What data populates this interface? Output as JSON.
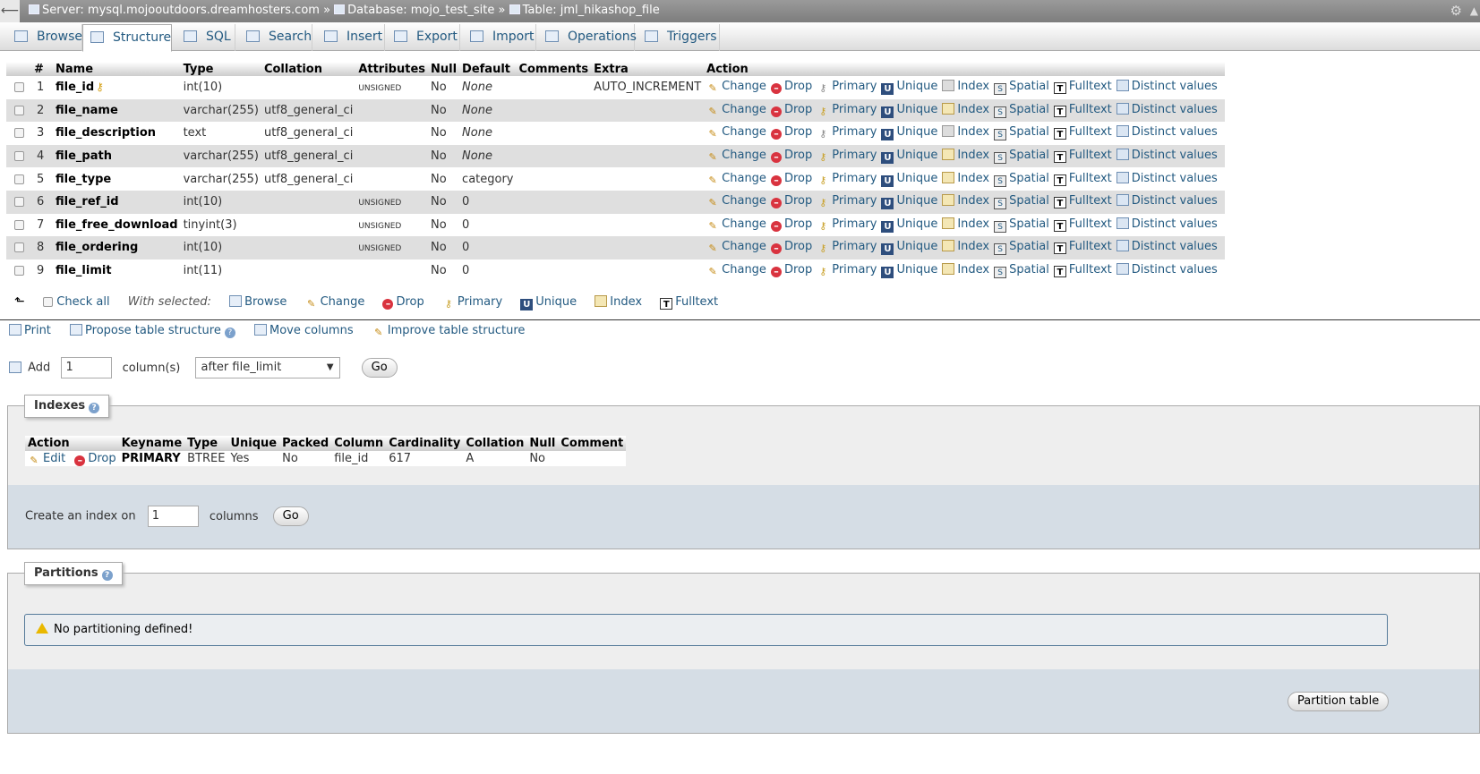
{
  "breadcrumb": {
    "server_label": "Server: mysql.mojooutdoors.dreamhosters.com »",
    "database_label": "Database: mojo_test_site »",
    "table_label": "Table: jml_hikashop_file"
  },
  "tabs": [
    {
      "label": "Browse",
      "icon": "browse-icon"
    },
    {
      "label": "Structure",
      "icon": "structure-icon",
      "active": true
    },
    {
      "label": "SQL",
      "icon": "sql-icon"
    },
    {
      "label": "Search",
      "icon": "search-icon"
    },
    {
      "label": "Insert",
      "icon": "insert-icon"
    },
    {
      "label": "Export",
      "icon": "export-icon"
    },
    {
      "label": "Import",
      "icon": "import-icon"
    },
    {
      "label": "Operations",
      "icon": "operations-icon"
    },
    {
      "label": "Triggers",
      "icon": "triggers-icon"
    }
  ],
  "structure": {
    "headers": [
      "#",
      "Name",
      "Type",
      "Collation",
      "Attributes",
      "Null",
      "Default",
      "Comments",
      "Extra",
      "Action"
    ],
    "rows": [
      {
        "num": "1",
        "name": "file_id",
        "type": "int(10)",
        "collation": "",
        "attributes": "UNSIGNED",
        "null": "No",
        "default": "None",
        "comments": "",
        "extra": "AUTO_INCREMENT"
      },
      {
        "num": "2",
        "name": "file_name",
        "type": "varchar(255)",
        "collation": "utf8_general_ci",
        "attributes": "",
        "null": "No",
        "default": "None",
        "comments": "",
        "extra": ""
      },
      {
        "num": "3",
        "name": "file_description",
        "type": "text",
        "collation": "utf8_general_ci",
        "attributes": "",
        "null": "No",
        "default": "None",
        "comments": "",
        "extra": ""
      },
      {
        "num": "4",
        "name": "file_path",
        "type": "varchar(255)",
        "collation": "utf8_general_ci",
        "attributes": "",
        "null": "No",
        "default": "None",
        "comments": "",
        "extra": ""
      },
      {
        "num": "5",
        "name": "file_type",
        "type": "varchar(255)",
        "collation": "utf8_general_ci",
        "attributes": "",
        "null": "No",
        "default": "category",
        "comments": "",
        "extra": ""
      },
      {
        "num": "6",
        "name": "file_ref_id",
        "type": "int(10)",
        "collation": "",
        "attributes": "UNSIGNED",
        "null": "No",
        "default": "0",
        "comments": "",
        "extra": ""
      },
      {
        "num": "7",
        "name": "file_free_download",
        "type": "tinyint(3)",
        "collation": "",
        "attributes": "UNSIGNED",
        "null": "No",
        "default": "0",
        "comments": "",
        "extra": ""
      },
      {
        "num": "8",
        "name": "file_ordering",
        "type": "int(10)",
        "collation": "",
        "attributes": "UNSIGNED",
        "null": "No",
        "default": "0",
        "comments": "",
        "extra": ""
      },
      {
        "num": "9",
        "name": "file_limit",
        "type": "int(11)",
        "collation": "",
        "attributes": "",
        "null": "No",
        "default": "0",
        "comments": "",
        "extra": ""
      }
    ],
    "actions": [
      "Change",
      "Drop",
      "Primary",
      "Unique",
      "Index",
      "Spatial",
      "Fulltext",
      "Distinct values"
    ]
  },
  "with_selected": {
    "check_all": "Check all",
    "label": "With selected:",
    "items": [
      "Browse",
      "Change",
      "Drop",
      "Primary",
      "Unique",
      "Index",
      "Fulltext"
    ]
  },
  "links": {
    "print": "Print",
    "propose": "Propose table structure",
    "move_columns": "Move columns",
    "improve": "Improve table structure"
  },
  "add_columns": {
    "label": "Add",
    "value": "1",
    "suffix": "column(s)",
    "position": "after file_limit",
    "go": "Go"
  },
  "indexes": {
    "legend": "Indexes",
    "headers": [
      "Action",
      "Keyname",
      "Type",
      "Unique",
      "Packed",
      "Column",
      "Cardinality",
      "Collation",
      "Null",
      "Comment"
    ],
    "rows": [
      {
        "edit": "Edit",
        "drop": "Drop",
        "keyname": "PRIMARY",
        "type": "BTREE",
        "unique": "Yes",
        "packed": "No",
        "column": "file_id",
        "cardinality": "617",
        "collation": "A",
        "null": "No",
        "comment": ""
      }
    ],
    "create_label": "Create an index on",
    "create_value": "1",
    "create_suffix": "columns",
    "go": "Go"
  },
  "partitions": {
    "legend": "Partitions",
    "message": "No partitioning defined!",
    "button": "Partition table"
  }
}
